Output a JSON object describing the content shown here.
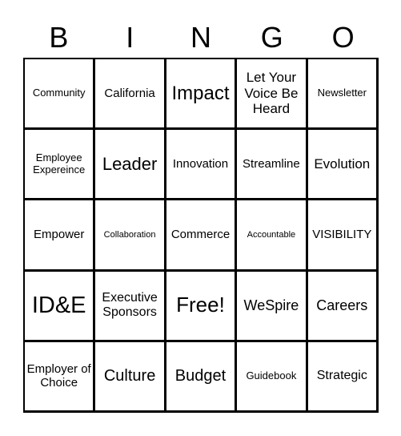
{
  "header": {
    "letters": [
      "B",
      "I",
      "N",
      "G",
      "O"
    ]
  },
  "board": {
    "rows": [
      [
        "Community",
        "California",
        "Impact",
        "Let Your Voice Be Heard",
        "Newsletter"
      ],
      [
        "Employee Expereince",
        "Leader",
        "Innovation",
        "Streamline",
        "Evolution"
      ],
      [
        "Empower",
        "Collaboration",
        "Commerce",
        "Accountable",
        "VISIBILITY"
      ],
      [
        "ID&E",
        "Executive Sponsors",
        "Free!",
        "WeSpire",
        "Careers"
      ],
      [
        "Employer of Choice",
        "Culture",
        "Budget",
        "Guidebook",
        "Strategic"
      ]
    ]
  }
}
